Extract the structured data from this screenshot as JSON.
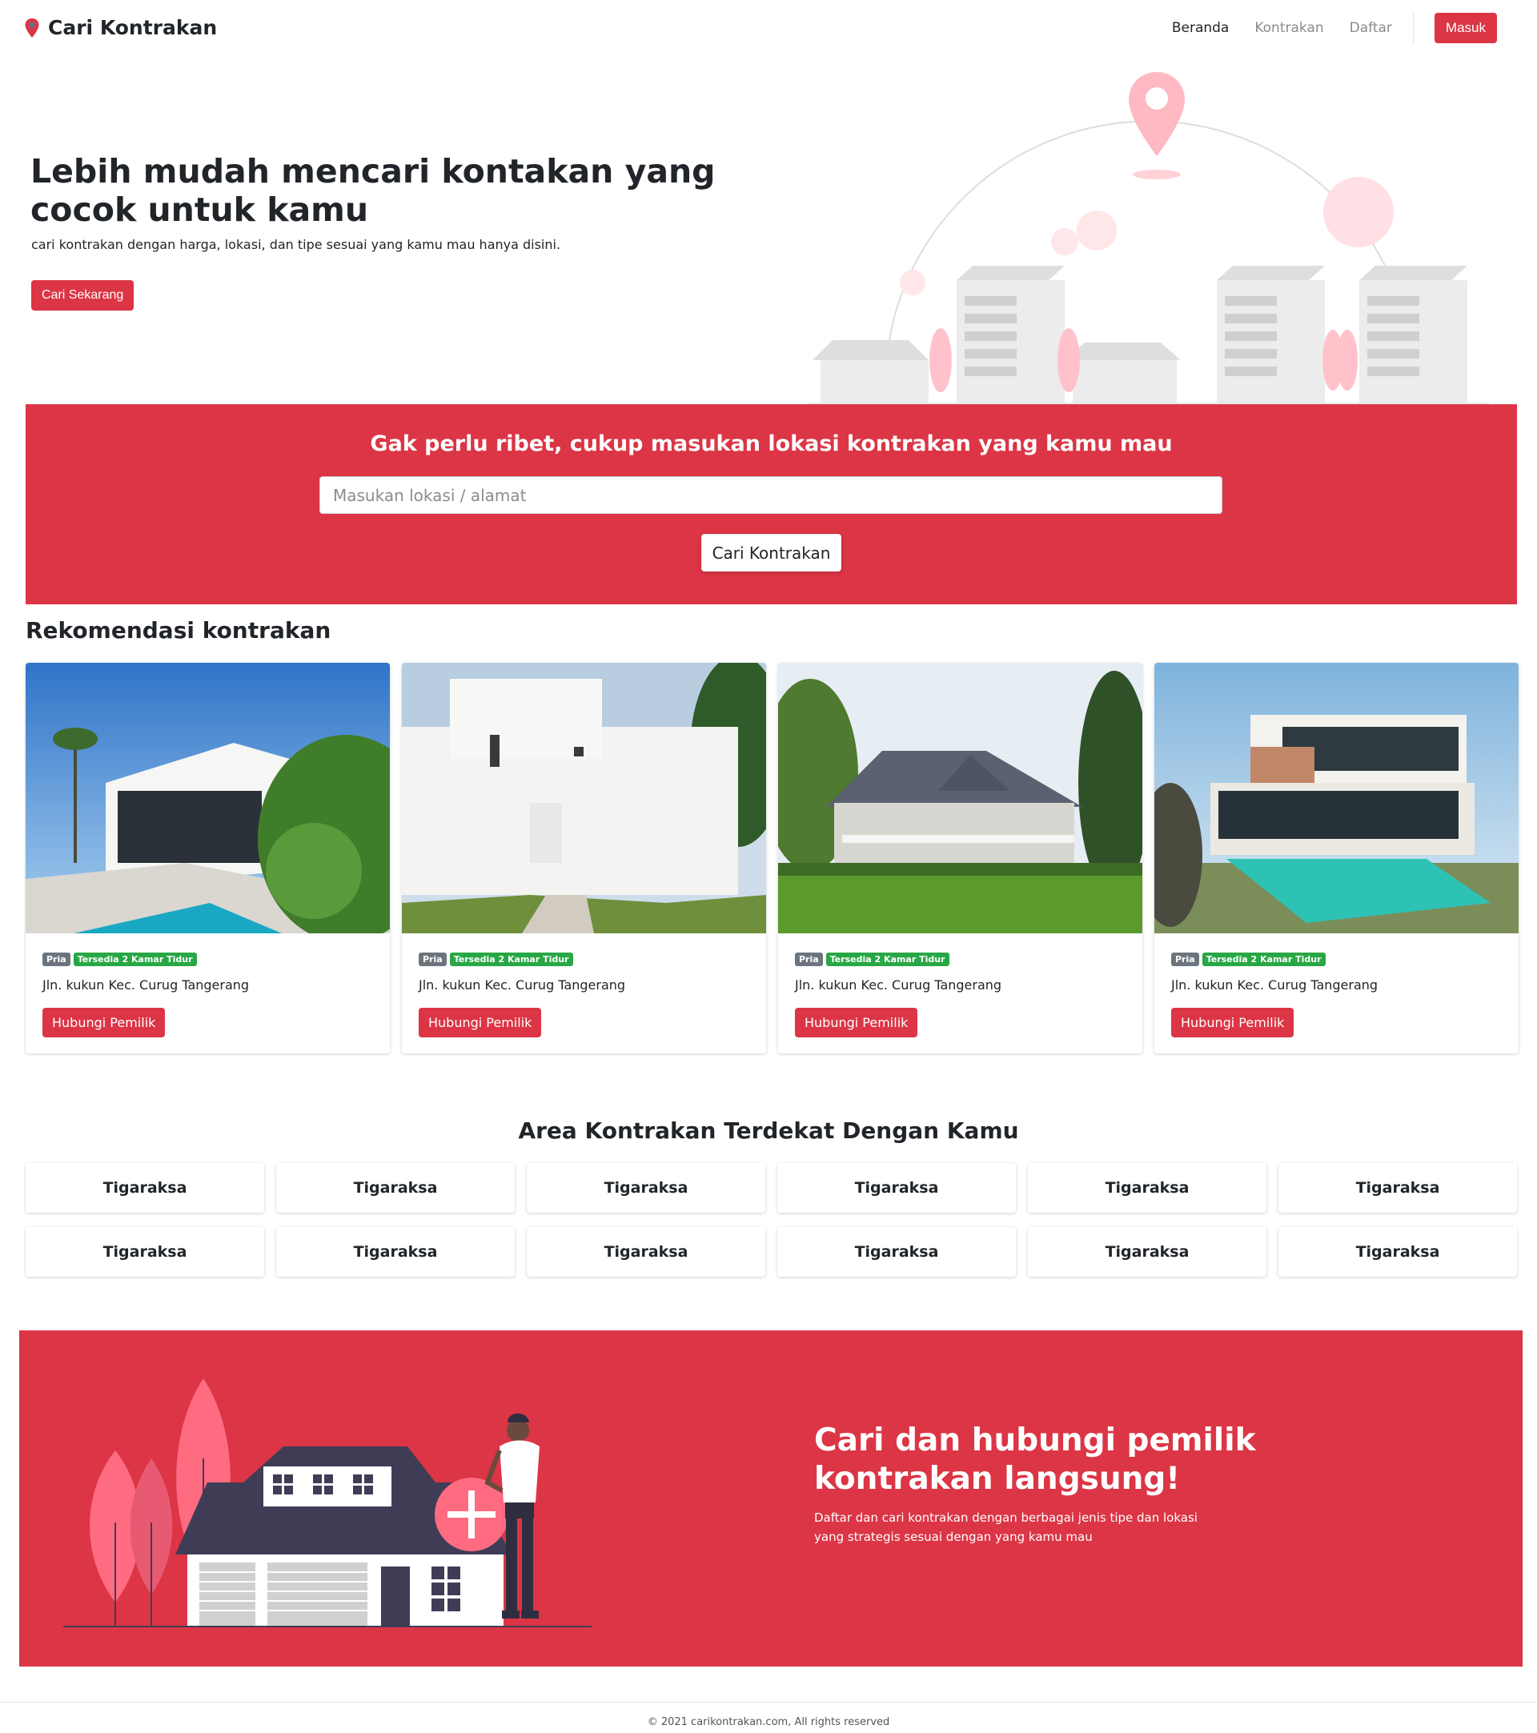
{
  "brand": {
    "name": "Cari Kontrakan",
    "icon": "map-pin-icon",
    "color": "#dc3545"
  },
  "nav": {
    "items": [
      {
        "label": "Beranda",
        "active": true
      },
      {
        "label": "Kontrakan",
        "active": false
      },
      {
        "label": "Daftar",
        "active": false
      }
    ],
    "login_label": "Masuk"
  },
  "hero": {
    "title": "Lebih mudah mencari kontakan yang cocok untuk kamu",
    "subtitle": "cari kontrakan dengan harga, lokasi, dan tipe sesuai yang kamu mau hanya disini.",
    "cta_label": "Cari Sekarang"
  },
  "search": {
    "title": "Gak perlu ribet, cukup masukan lokasi kontrakan yang kamu mau",
    "placeholder": "Masukan lokasi / alamat",
    "value": "",
    "button_label": "Cari Kontrakan"
  },
  "recommendations": {
    "title": "Rekomendasi kontrakan",
    "cards": [
      {
        "badge_gender": "Pria",
        "badge_rooms": "Tersedia 2 Kamar Tidur",
        "address": "Jln. kukun Kec. Curug Tangerang",
        "button_label": "Hubungi Pemilik"
      },
      {
        "badge_gender": "Pria",
        "badge_rooms": "Tersedia 2 Kamar Tidur",
        "address": "Jln. kukun Kec. Curug Tangerang",
        "button_label": "Hubungi Pemilik"
      },
      {
        "badge_gender": "Pria",
        "badge_rooms": "Tersedia 2 Kamar Tidur",
        "address": "Jln. kukun Kec. Curug Tangerang",
        "button_label": "Hubungi Pemilik"
      },
      {
        "badge_gender": "Pria",
        "badge_rooms": "Tersedia 2 Kamar Tidur",
        "address": "Jln. kukun Kec. Curug Tangerang",
        "button_label": "Hubungi Pemilik"
      }
    ]
  },
  "areas": {
    "title": "Area Kontrakan Terdekat Dengan Kamu",
    "items": [
      "Tigaraksa",
      "Tigaraksa",
      "Tigaraksa",
      "Tigaraksa",
      "Tigaraksa",
      "Tigaraksa",
      "Tigaraksa",
      "Tigaraksa",
      "Tigaraksa",
      "Tigaraksa",
      "Tigaraksa",
      "Tigaraksa"
    ]
  },
  "cta": {
    "title": "Cari dan hubungi pemilik kontrakan langsung!",
    "description": "Daftar dan cari kontrakan dengan berbagai jenis tipe dan lokasi yang strategis sesuai dengan yang kamu mau"
  },
  "footer": {
    "text": "© 2021 carikontrakan.com, All rights reserved"
  },
  "colors": {
    "primary": "#dc3545",
    "success": "#28a745",
    "secondary": "#6c757d"
  }
}
